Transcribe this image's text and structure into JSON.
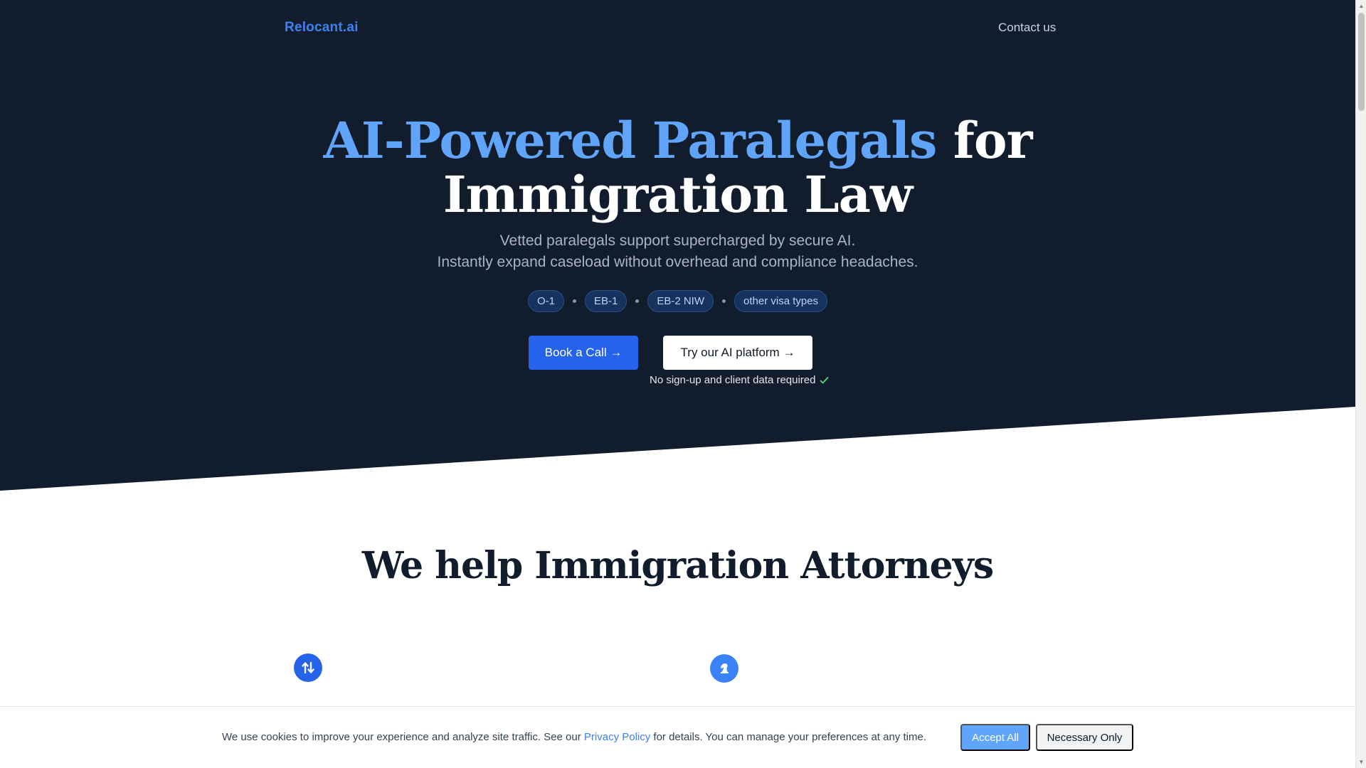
{
  "nav": {
    "logo": "Relocant.ai",
    "contact": "Contact us"
  },
  "hero": {
    "title_accent": "AI-Powered Paralegals",
    "title_rest_1": "for",
    "title_rest_2": "Immigration Law",
    "subtitle_line1": "Vetted paralegals support supercharged by secure AI.",
    "subtitle_line2": "Instantly expand caseload without overhead and compliance headaches.",
    "tags": [
      "O-1",
      "EB-1",
      "EB-2 NIW",
      "other visa types"
    ],
    "book_call": "Book a Call →",
    "try_platform": "Try our AI platform →",
    "note": "No sign-up and client data required"
  },
  "section": {
    "title": "We help Immigration Attorneys",
    "feature_icons": [
      "swap-vertical-icon",
      "chess-knight-icon"
    ]
  },
  "cookie": {
    "text_before": "We use cookies to improve your experience and analyze site traffic. See our ",
    "link": "Privacy Policy",
    "text_after": " for details. You can manage your preferences at any time.",
    "accept": "Accept All",
    "necessary": "Necessary Only"
  },
  "colors": {
    "hero_bg": "#111c2d",
    "accent": "#60a5fa",
    "primary": "#2563eb"
  }
}
